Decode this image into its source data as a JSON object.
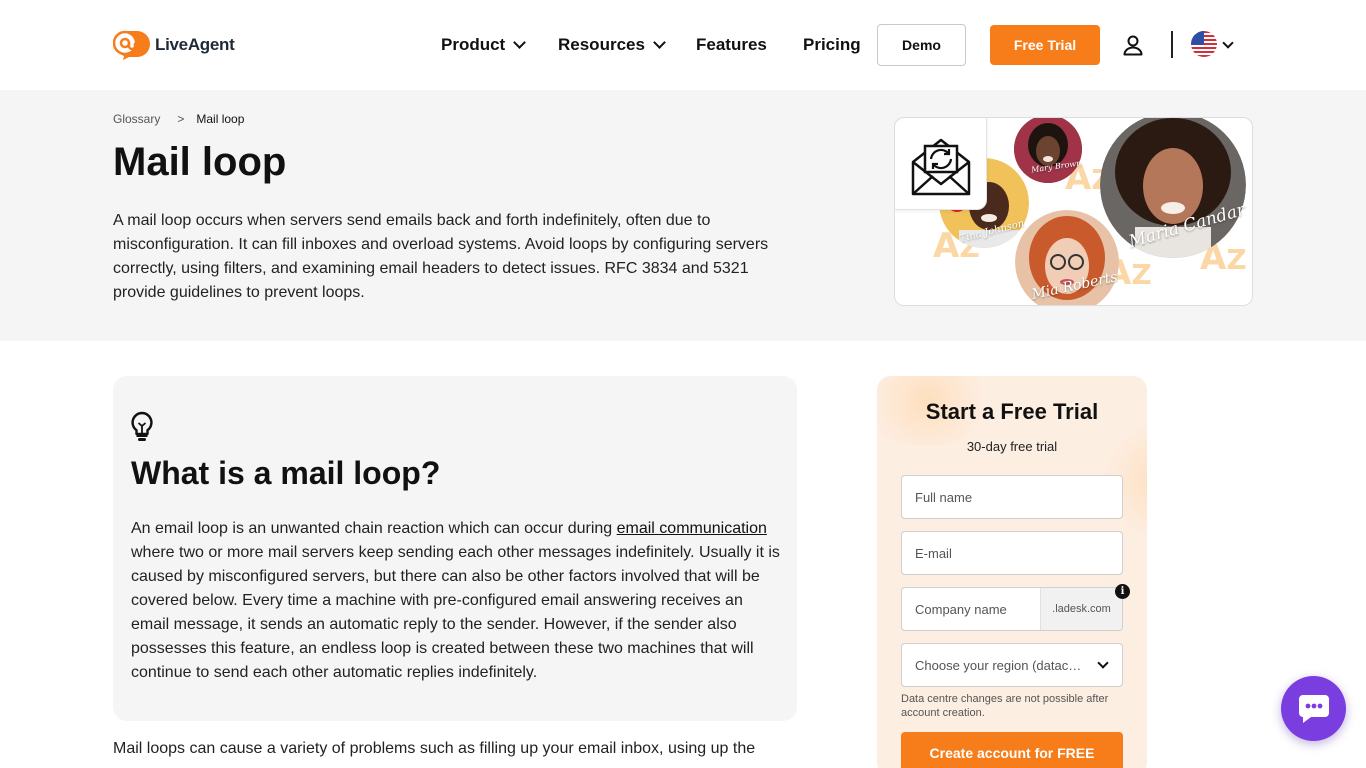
{
  "brand": {
    "name": "LiveAgent",
    "accent": "#f67d1a",
    "chat_color": "#7a3ee0"
  },
  "nav": {
    "items": [
      {
        "label": "Product",
        "has_dropdown": true
      },
      {
        "label": "Resources",
        "has_dropdown": true
      },
      {
        "label": "Features",
        "has_dropdown": false
      },
      {
        "label": "Pricing",
        "has_dropdown": false
      }
    ],
    "demo_label": "Demo",
    "trial_label": "Free Trial",
    "account_icon": "user-icon",
    "language_icon": "us-flag-icon"
  },
  "breadcrumb": {
    "parent": "Glossary",
    "separator": ">",
    "current": "Mail loop"
  },
  "hero": {
    "title": "Mail loop",
    "intro": "A mail loop occurs when servers send emails back and forth indefinitely, often due to misconfiguration. It can fill inboxes and overload systems. Avoid loops by configuring servers correctly, using filters, and examining email headers to detect issues. RFC 3834 and 5321 provide guidelines to prevent loops.",
    "image": {
      "icon": "mail-loop-icon",
      "names": [
        "Mary Brown",
        "Tina Johnson",
        "Maria Candar",
        "Mia Roberts"
      ]
    }
  },
  "section": {
    "icon": "lightbulb-icon",
    "title": "What is a mail loop?",
    "text_before_link": "An email loop is an unwanted chain reaction which can occur during ",
    "link_text": "email communication",
    "text_after_link": " where two or more mail servers keep sending each other messages indefinitely. Usually it is caused by misconfigured servers, but there can also be other factors involved that will be covered below. Every time a machine with pre-configured email answering receives an email message, it sends an automatic reply to the sender. However, if the sender also possesses this feature, an endless loop is created between these two machines that will continue to send each other automatic replies indefinitely."
  },
  "body_text": "Mail loops can cause a variety of problems such as filling up your email inbox, using up the",
  "trial_form": {
    "title": "Start a Free Trial",
    "subtitle": "30-day free trial",
    "fullname_placeholder": "Full name",
    "email_placeholder": "E-mail",
    "company_placeholder": "Company name",
    "domain_suffix": ".ladesk.com",
    "region_placeholder": "Choose your region (datacenter)",
    "note": "Data centre changes are not possible after account creation.",
    "submit_label": "Create account for FREE"
  }
}
